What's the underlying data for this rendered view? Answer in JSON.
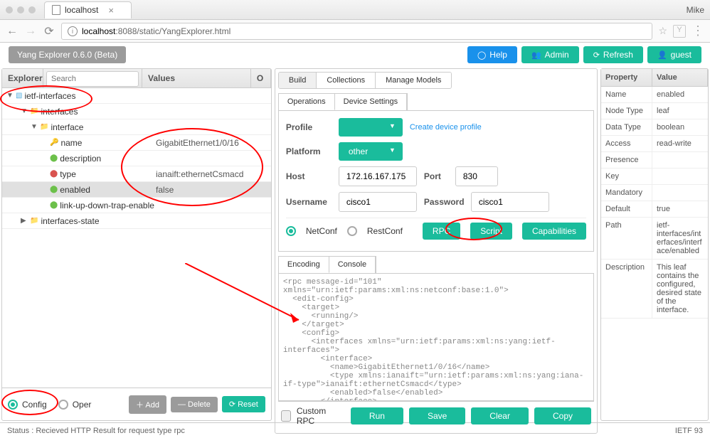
{
  "browser": {
    "tab_title": "localhost",
    "user": "Mike",
    "url_host": "localhost",
    "url_rest": ":8088/static/YangExplorer.html"
  },
  "app_title": "Yang Explorer 0.6.0 (Beta)",
  "header_buttons": {
    "help": "Help",
    "admin": "Admin",
    "refresh": "Refresh",
    "guest": "guest"
  },
  "explorer": {
    "title": "Explorer",
    "search_placeholder": "Search",
    "cols": {
      "values": "Values",
      "op": "O"
    },
    "rows": [
      {
        "name": "ietf-interfaces",
        "icon": "module",
        "arrow": "▼",
        "indent": 0,
        "value": "",
        "selected": false
      },
      {
        "name": "interfaces",
        "icon": "folder",
        "arrow": "▼",
        "indent": 1,
        "value": "",
        "selected": false
      },
      {
        "name": "interface",
        "icon": "folder",
        "arrow": "▼",
        "indent": 2,
        "value": "",
        "selected": false
      },
      {
        "name": "name",
        "icon": "key",
        "arrow": "",
        "indent": 3,
        "value": "GigabitEthernet1/0/16",
        "selected": false
      },
      {
        "name": "description",
        "icon": "leaf",
        "arrow": "",
        "indent": 3,
        "value": "",
        "selected": false
      },
      {
        "name": "type",
        "icon": "leaf-red",
        "arrow": "",
        "indent": 3,
        "value": "ianaift:ethernetCsmacd",
        "selected": false
      },
      {
        "name": "enabled",
        "icon": "leaf",
        "arrow": "",
        "indent": 3,
        "value": "false",
        "selected": true
      },
      {
        "name": "link-up-down-trap-enable",
        "icon": "leaf",
        "arrow": "",
        "indent": 3,
        "value": "",
        "selected": false
      },
      {
        "name": "interfaces-state",
        "icon": "folder",
        "arrow": "▶",
        "indent": 1,
        "value": "",
        "selected": false
      }
    ],
    "footer": {
      "config": "Config",
      "oper": "Oper",
      "add": "Add",
      "delete": "Delete",
      "reset": "Reset"
    }
  },
  "center": {
    "top_tabs": [
      "Build",
      "Collections",
      "Manage Models"
    ],
    "sub_tabs": [
      "Operations",
      "Device Settings"
    ],
    "form": {
      "profile_lbl": "Profile",
      "create_profile": "Create device profile",
      "platform_lbl": "Platform",
      "platform_val": "other",
      "host_lbl": "Host",
      "host_val": "172.16.167.175",
      "port_lbl": "Port",
      "port_val": "830",
      "user_lbl": "Username",
      "user_val": "cisco1",
      "pass_lbl": "Password",
      "pass_val": "cisco1"
    },
    "proto": {
      "netconf": "NetConf",
      "restconf": "RestConf",
      "rpc": "RPC",
      "script": "Script",
      "caps": "Capabilities"
    },
    "code_tabs": [
      "Encoding",
      "Console"
    ],
    "rpc_code": "<rpc message-id=\"101\"\nxmlns=\"urn:ietf:params:xml:ns:netconf:base:1.0\">\n  <edit-config>\n    <target>\n      <running/>\n    </target>\n    <config>\n      <interfaces xmlns=\"urn:ietf:params:xml:ns:yang:ietf-interfaces\">\n        <interface>\n          <name>GigabitEthernet1/0/16</name>\n          <type xmlns:ianaift=\"urn:ietf:params:xml:ns:yang:iana-if-type\">ianaift:ethernetCsmacd</type>\n          <enabled>false</enabled>\n        </interface>",
    "rpc_footer": {
      "custom": "Custom RPC",
      "run": "Run",
      "save": "Save",
      "clear": "Clear",
      "copy": "Copy"
    }
  },
  "property": {
    "cols": {
      "prop": "Property",
      "val": "Value"
    },
    "rows": [
      {
        "k": "Name",
        "v": "enabled"
      },
      {
        "k": "Node Type",
        "v": "leaf"
      },
      {
        "k": "Data Type",
        "v": "boolean"
      },
      {
        "k": "Access",
        "v": "read-write"
      },
      {
        "k": "Presence",
        "v": ""
      },
      {
        "k": "Key",
        "v": ""
      },
      {
        "k": "Mandatory",
        "v": ""
      },
      {
        "k": "Default",
        "v": "true"
      },
      {
        "k": "Path",
        "v": "ietf-interfaces/interfaces/interface/enabled"
      },
      {
        "k": "Description",
        "v": "This leaf contains the configured, desired state of the interface."
      }
    ]
  },
  "status": {
    "left": "Status : Recieved HTTP Result for request type rpc",
    "right": "IETF 93"
  }
}
